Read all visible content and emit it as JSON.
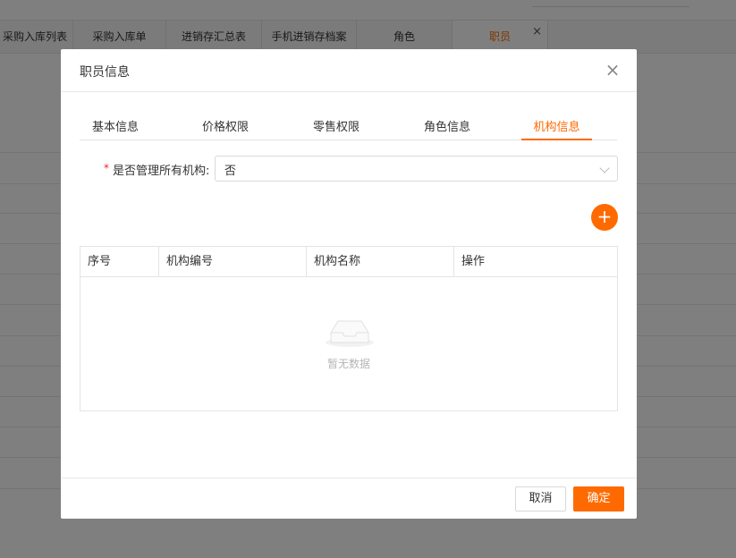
{
  "background": {
    "tabs": [
      {
        "label": "采购入库列表"
      },
      {
        "label": "采购入库单"
      },
      {
        "label": "进销存汇总表"
      },
      {
        "label": "手机进销存档案"
      },
      {
        "label": "角色"
      },
      {
        "label": "职员",
        "active": true
      }
    ],
    "close_glyph": "×"
  },
  "dialog": {
    "title": "职员信息",
    "close_glyph": "×",
    "tabs": [
      {
        "label": "基本信息"
      },
      {
        "label": "价格权限"
      },
      {
        "label": "零售权限"
      },
      {
        "label": "角色信息"
      },
      {
        "label": "机构信息",
        "active": true
      }
    ],
    "form": {
      "required_mark": "*",
      "manage_all_label": "是否管理所有机构:",
      "manage_all_value": "否"
    },
    "add_button_glyph": "+",
    "table": {
      "columns": [
        "序号",
        "机构编号",
        "机构名称",
        "操作"
      ],
      "rows": [],
      "empty_text": "暂无数据"
    },
    "footer": {
      "cancel_label": "取消",
      "confirm_label": "确定"
    }
  },
  "colors": {
    "accent": "#ff6a00",
    "required": "#f5222d"
  },
  "icons": {
    "close": "close-icon",
    "add": "plus-icon",
    "empty": "empty-inbox-icon",
    "select_arrow": "chevron-down-icon"
  }
}
